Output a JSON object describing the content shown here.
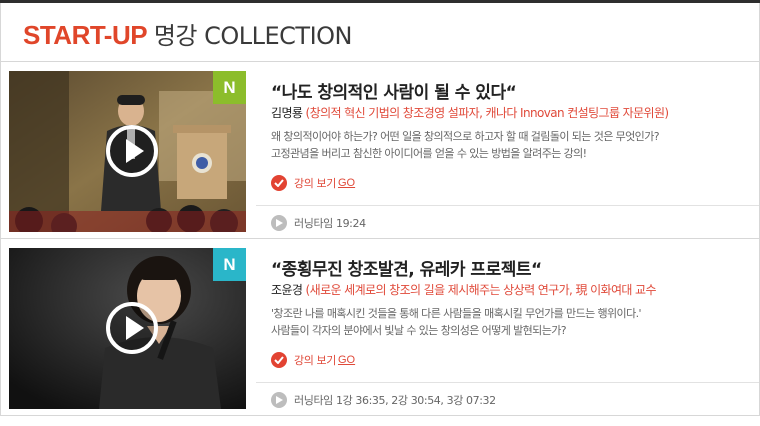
{
  "header": {
    "title_accent": "START-UP",
    "title_rest": "명강 COLLECTION"
  },
  "colors": {
    "accent": "#e0462a",
    "badge_green": "#8cbd2b",
    "badge_blue": "#2ab6c9"
  },
  "lectures": [
    {
      "badge": "N",
      "title": "“나도 창의적인 사람이 될 수 있다“",
      "speaker_name": "김명룡",
      "speaker_role": "(창의적 혁신 기법의 창조경영 설파자, 캐나다 Innovan 컨설팅그룹 자문위원)",
      "desc_line1": "왜 창의적이어야 하는가? 어떤 일을 창의적으로 하고자 할 때 걸림돌이 되는 것은 무엇인가?",
      "desc_line2": "고정관념을 버리고 참신한 아이디어를 얻을 수 있는 방법을 알려주는 강의!",
      "watch_label": "강의 보기",
      "watch_go": "GO",
      "runtime": "러닝타임 19:24"
    },
    {
      "badge": "N",
      "title": "“종횡무진 창조발견, 유레카 프로젝트“",
      "speaker_name": "조윤경",
      "speaker_role": "(새로운 세계로의 창조의 길을 제시해주는 상상력 연구가, 現 이화여대 교수",
      "desc_line1": "'창조란 나를 매혹시킨 것들을 통해 다른 사람들을 매혹시킬 무언가를 만드는 행위이다.'",
      "desc_line2": "사람들이 각자의 분야에서 빛날 수 있는 창의성은 어떻게 발현되는가?",
      "watch_label": "강의 보기",
      "watch_go": "GO",
      "runtime": "러닝타임 1강 36:35, 2강 30:54, 3강 07:32"
    }
  ]
}
